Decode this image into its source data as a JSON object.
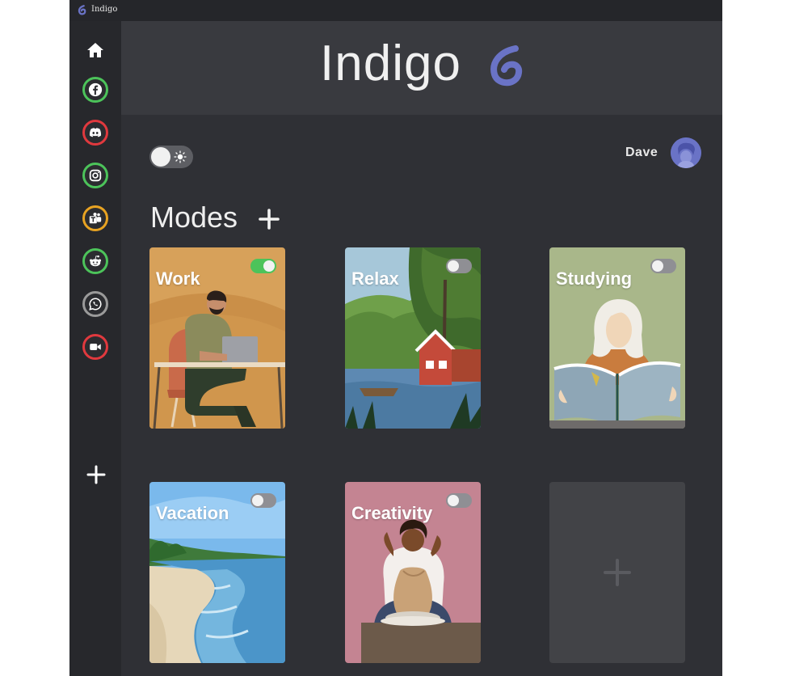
{
  "window": {
    "title": "Indigo"
  },
  "brand": {
    "name": "Indigo"
  },
  "user": {
    "name": "Dave"
  },
  "sidebar": {
    "items": [
      {
        "name": "facebook",
        "ring": "#4cc35a"
      },
      {
        "name": "discord",
        "ring": "#e0393e"
      },
      {
        "name": "instagram",
        "ring": "#4cc35a"
      },
      {
        "name": "teams",
        "ring": "#e8a322"
      },
      {
        "name": "reddit",
        "ring": "#4cc35a"
      },
      {
        "name": "whatsapp",
        "ring": "#9a9a9a"
      },
      {
        "name": "zoom",
        "ring": "#e0393e"
      }
    ]
  },
  "modes": {
    "title": "Modes",
    "cards": [
      {
        "label": "Work",
        "enabled": true
      },
      {
        "label": "Relax",
        "enabled": false
      },
      {
        "label": "Studying",
        "enabled": false
      },
      {
        "label": "Vacation",
        "enabled": false
      },
      {
        "label": "Creativity",
        "enabled": false
      }
    ]
  },
  "colors": {
    "accent": "#6a73c6",
    "toggle_on": "#4cc35a",
    "toggle_off": "#8f8f94"
  }
}
